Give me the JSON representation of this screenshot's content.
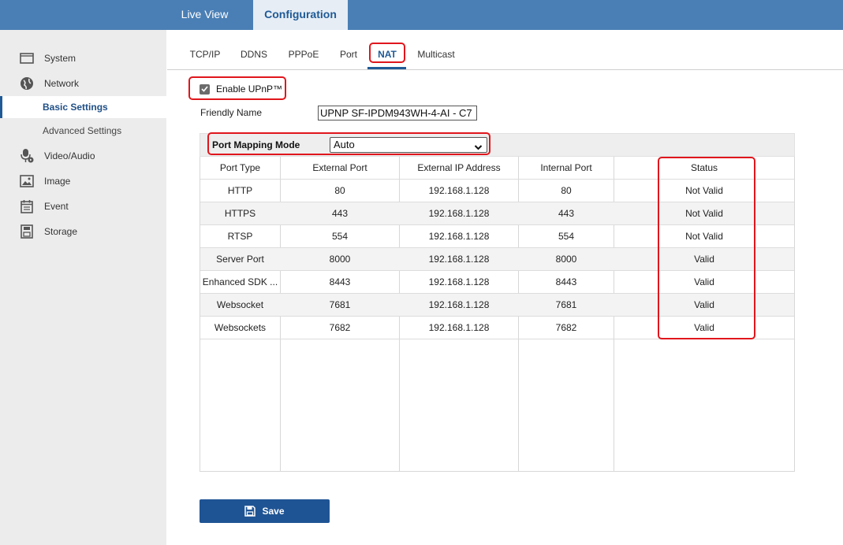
{
  "top_tabs": {
    "live_view": "Live View",
    "configuration": "Configuration"
  },
  "sidebar": {
    "system": "System",
    "network": "Network",
    "basic_settings": "Basic Settings",
    "advanced_settings": "Advanced Settings",
    "video_audio": "Video/Audio",
    "image": "Image",
    "event": "Event",
    "storage": "Storage"
  },
  "sub_tabs": [
    "TCP/IP",
    "DDNS",
    "PPPoE",
    "Port",
    "NAT",
    "Multicast"
  ],
  "active_sub_tab": "NAT",
  "form": {
    "enable_upnp_label": "Enable UPnP™",
    "enable_upnp_checked": true,
    "friendly_name_label": "Friendly Name",
    "friendly_name_value": "UPNP SF-IPDM943WH-4-AI - C7",
    "port_mapping_mode_label": "Port Mapping Mode",
    "port_mapping_mode_value": "Auto"
  },
  "table": {
    "headers": [
      "Port Type",
      "External Port",
      "External IP Address",
      "Internal Port",
      "Status"
    ],
    "rows": [
      [
        "HTTP",
        "80",
        "192.168.1.128",
        "80",
        "Not Valid"
      ],
      [
        "HTTPS",
        "443",
        "192.168.1.128",
        "443",
        "Not Valid"
      ],
      [
        "RTSP",
        "554",
        "192.168.1.128",
        "554",
        "Not Valid"
      ],
      [
        "Server Port",
        "8000",
        "192.168.1.128",
        "8000",
        "Valid"
      ],
      [
        "Enhanced SDK ...",
        "8443",
        "192.168.1.128",
        "8443",
        "Valid"
      ],
      [
        "Websocket",
        "7681",
        "192.168.1.128",
        "7681",
        "Valid"
      ],
      [
        "Websockets",
        "7682",
        "192.168.1.128",
        "7682",
        "Valid"
      ]
    ]
  },
  "buttons": {
    "save": "Save"
  },
  "colors": {
    "topbar": "#4a7fb5",
    "accent": "#1f5a96",
    "highlight": "#e0161c",
    "save_button": "#1f5494"
  },
  "icons": [
    "monitor-icon",
    "globe-icon",
    "microphone-icon",
    "image-icon",
    "calendar-icon",
    "storage-icon",
    "save-disk-icon",
    "chevron-down-icon",
    "checkbox-check-icon"
  ]
}
